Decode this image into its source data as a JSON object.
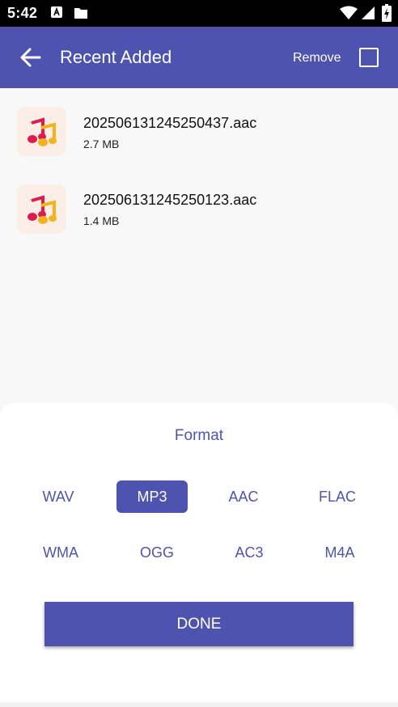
{
  "status_bar": {
    "time": "5:42"
  },
  "app_bar": {
    "title": "Recent Added",
    "remove_label": "Remove"
  },
  "files": [
    {
      "name": "202506131245250437.aac",
      "size": "2.7 MB"
    },
    {
      "name": "202506131245250123.aac",
      "size": "1.4 MB"
    }
  ],
  "format_sheet": {
    "heading": "Format",
    "formats_row1": [
      "WAV",
      "MP3",
      "AAC",
      "FLAC"
    ],
    "formats_row2": [
      "WMA",
      "OGG",
      "AC3",
      "M4A"
    ],
    "selected": "MP3",
    "done_label": "DONE"
  },
  "colors": {
    "primary": "#4f53b0",
    "background": "#f8f8f9"
  }
}
